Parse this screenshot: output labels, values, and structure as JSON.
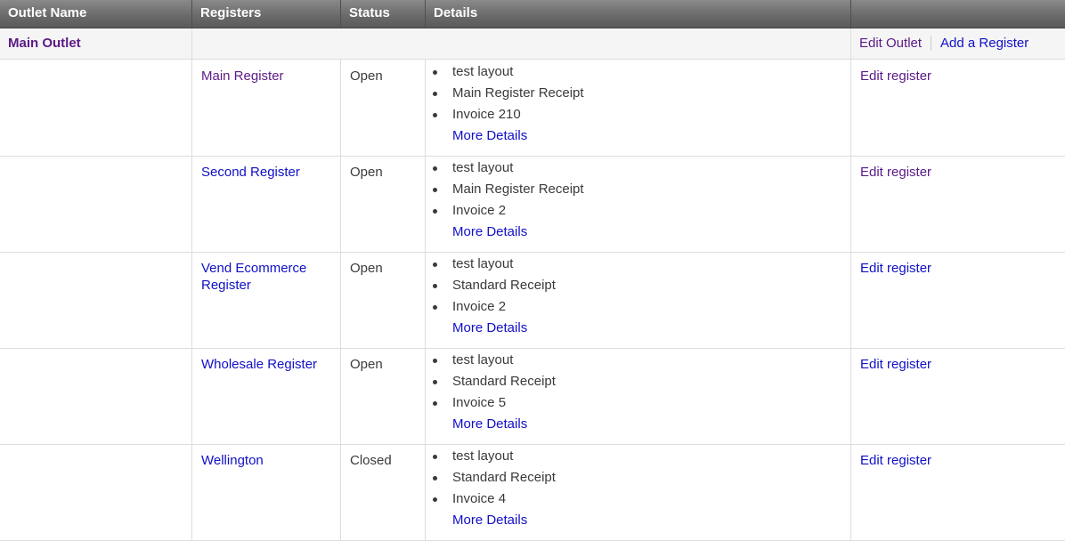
{
  "header": {
    "outlet_name": "Outlet Name",
    "registers": "Registers",
    "status": "Status",
    "details": "Details",
    "actions": ""
  },
  "outlet": {
    "name": "Main Outlet",
    "edit_label": "Edit Outlet",
    "add_register_label": "Add a Register"
  },
  "registers": [
    {
      "name": "Main Register",
      "status": "Open",
      "details": [
        "test layout",
        "Main Register Receipt",
        "Invoice 210"
      ],
      "more": "More Details",
      "edit": "Edit register"
    },
    {
      "name": "Second Register",
      "status": "Open",
      "details": [
        "test layout",
        "Main Register Receipt",
        "Invoice 2"
      ],
      "more": "More Details",
      "edit": "Edit register"
    },
    {
      "name": "Vend Ecommerce Register",
      "status": "Open",
      "details": [
        "test layout",
        "Standard Receipt",
        "Invoice 2"
      ],
      "more": "More Details",
      "edit": "Edit register"
    },
    {
      "name": "Wholesale Register",
      "status": "Open",
      "details": [
        "test layout",
        "Standard Receipt",
        "Invoice 5"
      ],
      "more": "More Details",
      "edit": "Edit register"
    },
    {
      "name": "Wellington",
      "status": "Closed",
      "details": [
        "test layout",
        "Standard Receipt",
        "Invoice 4"
      ],
      "more": "More Details",
      "edit": "Edit register"
    }
  ],
  "colors": {
    "visited_link": "#5b1a86",
    "link": "#1010c8"
  }
}
